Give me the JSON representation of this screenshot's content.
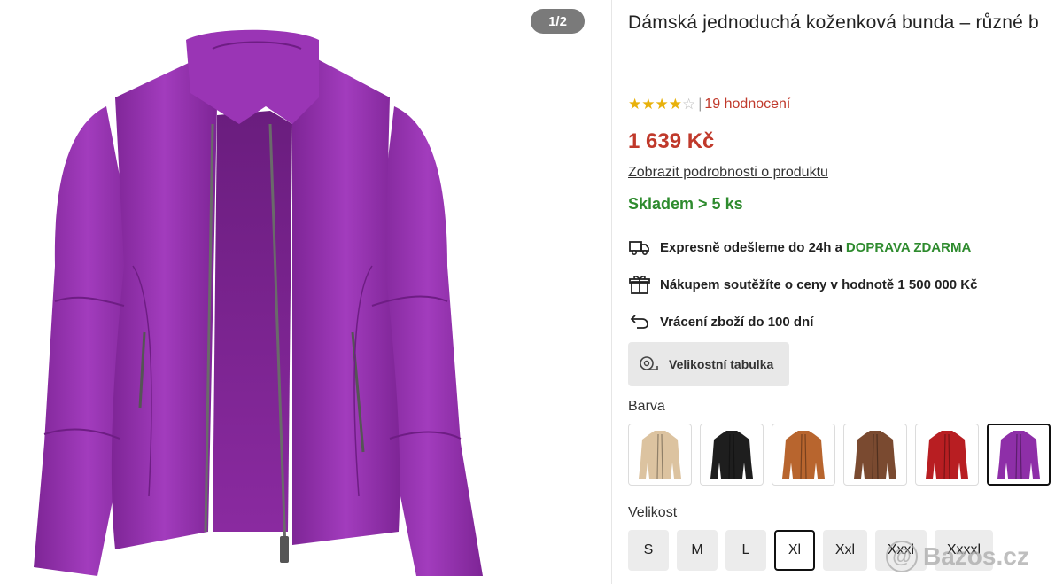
{
  "gallery": {
    "counter": "1/2",
    "image_alt": "purple leather jacket"
  },
  "product": {
    "title": "Dámská jednoduchá koženková bunda – různé b",
    "rating": {
      "stars_filled": 4,
      "stars_total": 5,
      "separator": "|",
      "reviews_text": "19 hodnocení"
    },
    "price": "1 639 Kč",
    "details_link": "Zobrazit podrobnosti o produktu",
    "stock": "Skladem > 5 ks",
    "benefits": [
      {
        "icon": "truck-icon",
        "text": "Expresně odešleme do 24h a ",
        "highlight": "DOPRAVA ZDARMA"
      },
      {
        "icon": "gift-icon",
        "text": "Nákupem soutěžíte o ceny v hodnotě 1 500 000 Kč",
        "highlight": ""
      },
      {
        "icon": "return-arrow-icon",
        "text": "Vrácení zboží do 100 dní",
        "highlight": ""
      }
    ],
    "size_chart_label": "Velikostní tabulka",
    "color_label": "Barva",
    "colors": [
      {
        "name": "beige",
        "hex": "#dcc3a0"
      },
      {
        "name": "black",
        "hex": "#1e1e1e"
      },
      {
        "name": "brown",
        "hex": "#b8652e"
      },
      {
        "name": "coffee",
        "hex": "#7a4a30"
      },
      {
        "name": "red",
        "hex": "#b81e22"
      },
      {
        "name": "purple",
        "hex": "#8e2fa8"
      }
    ],
    "selected_color_index": 5,
    "size_label": "Velikost",
    "sizes": [
      "S",
      "M",
      "L",
      "Xl",
      "Xxl",
      "Xxxl",
      "Xxxxl"
    ],
    "selected_size_index": 3
  },
  "watermark": {
    "symbol": "@",
    "text": "Bazos.cz"
  },
  "colors": {
    "price": "#c0392b",
    "stock": "#2e8b2e",
    "star": "#e8b10b",
    "jacket": "#8e2fa8"
  }
}
